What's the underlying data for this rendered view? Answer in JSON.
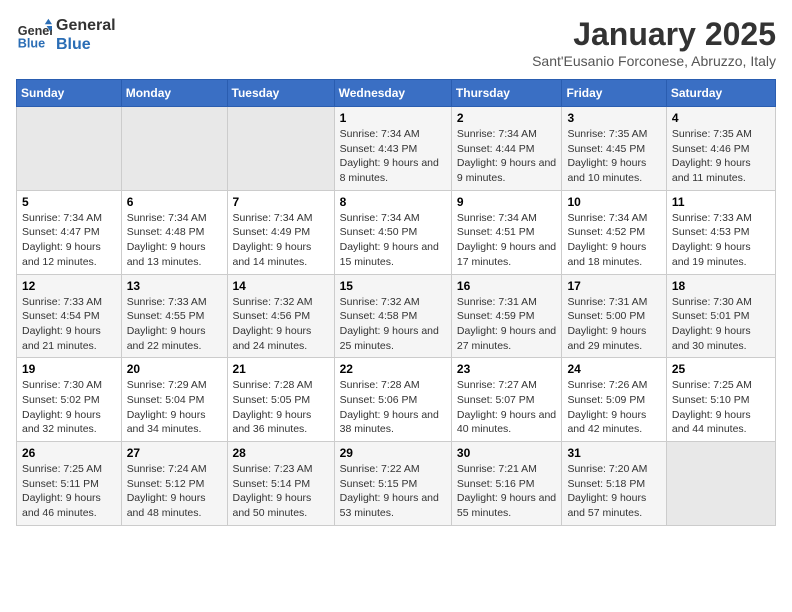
{
  "logo": {
    "text_general": "General",
    "text_blue": "Blue"
  },
  "header": {
    "title": "January 2025",
    "subtitle": "Sant'Eusanio Forconese, Abruzzo, Italy"
  },
  "days_of_week": [
    "Sunday",
    "Monday",
    "Tuesday",
    "Wednesday",
    "Thursday",
    "Friday",
    "Saturday"
  ],
  "weeks": [
    [
      {
        "day": "",
        "info": ""
      },
      {
        "day": "",
        "info": ""
      },
      {
        "day": "",
        "info": ""
      },
      {
        "day": "1",
        "info": "Sunrise: 7:34 AM\nSunset: 4:43 PM\nDaylight: 9 hours and 8 minutes."
      },
      {
        "day": "2",
        "info": "Sunrise: 7:34 AM\nSunset: 4:44 PM\nDaylight: 9 hours and 9 minutes."
      },
      {
        "day": "3",
        "info": "Sunrise: 7:35 AM\nSunset: 4:45 PM\nDaylight: 9 hours and 10 minutes."
      },
      {
        "day": "4",
        "info": "Sunrise: 7:35 AM\nSunset: 4:46 PM\nDaylight: 9 hours and 11 minutes."
      }
    ],
    [
      {
        "day": "5",
        "info": "Sunrise: 7:34 AM\nSunset: 4:47 PM\nDaylight: 9 hours and 12 minutes."
      },
      {
        "day": "6",
        "info": "Sunrise: 7:34 AM\nSunset: 4:48 PM\nDaylight: 9 hours and 13 minutes."
      },
      {
        "day": "7",
        "info": "Sunrise: 7:34 AM\nSunset: 4:49 PM\nDaylight: 9 hours and 14 minutes."
      },
      {
        "day": "8",
        "info": "Sunrise: 7:34 AM\nSunset: 4:50 PM\nDaylight: 9 hours and 15 minutes."
      },
      {
        "day": "9",
        "info": "Sunrise: 7:34 AM\nSunset: 4:51 PM\nDaylight: 9 hours and 17 minutes."
      },
      {
        "day": "10",
        "info": "Sunrise: 7:34 AM\nSunset: 4:52 PM\nDaylight: 9 hours and 18 minutes."
      },
      {
        "day": "11",
        "info": "Sunrise: 7:33 AM\nSunset: 4:53 PM\nDaylight: 9 hours and 19 minutes."
      }
    ],
    [
      {
        "day": "12",
        "info": "Sunrise: 7:33 AM\nSunset: 4:54 PM\nDaylight: 9 hours and 21 minutes."
      },
      {
        "day": "13",
        "info": "Sunrise: 7:33 AM\nSunset: 4:55 PM\nDaylight: 9 hours and 22 minutes."
      },
      {
        "day": "14",
        "info": "Sunrise: 7:32 AM\nSunset: 4:56 PM\nDaylight: 9 hours and 24 minutes."
      },
      {
        "day": "15",
        "info": "Sunrise: 7:32 AM\nSunset: 4:58 PM\nDaylight: 9 hours and 25 minutes."
      },
      {
        "day": "16",
        "info": "Sunrise: 7:31 AM\nSunset: 4:59 PM\nDaylight: 9 hours and 27 minutes."
      },
      {
        "day": "17",
        "info": "Sunrise: 7:31 AM\nSunset: 5:00 PM\nDaylight: 9 hours and 29 minutes."
      },
      {
        "day": "18",
        "info": "Sunrise: 7:30 AM\nSunset: 5:01 PM\nDaylight: 9 hours and 30 minutes."
      }
    ],
    [
      {
        "day": "19",
        "info": "Sunrise: 7:30 AM\nSunset: 5:02 PM\nDaylight: 9 hours and 32 minutes."
      },
      {
        "day": "20",
        "info": "Sunrise: 7:29 AM\nSunset: 5:04 PM\nDaylight: 9 hours and 34 minutes."
      },
      {
        "day": "21",
        "info": "Sunrise: 7:28 AM\nSunset: 5:05 PM\nDaylight: 9 hours and 36 minutes."
      },
      {
        "day": "22",
        "info": "Sunrise: 7:28 AM\nSunset: 5:06 PM\nDaylight: 9 hours and 38 minutes."
      },
      {
        "day": "23",
        "info": "Sunrise: 7:27 AM\nSunset: 5:07 PM\nDaylight: 9 hours and 40 minutes."
      },
      {
        "day": "24",
        "info": "Sunrise: 7:26 AM\nSunset: 5:09 PM\nDaylight: 9 hours and 42 minutes."
      },
      {
        "day": "25",
        "info": "Sunrise: 7:25 AM\nSunset: 5:10 PM\nDaylight: 9 hours and 44 minutes."
      }
    ],
    [
      {
        "day": "26",
        "info": "Sunrise: 7:25 AM\nSunset: 5:11 PM\nDaylight: 9 hours and 46 minutes."
      },
      {
        "day": "27",
        "info": "Sunrise: 7:24 AM\nSunset: 5:12 PM\nDaylight: 9 hours and 48 minutes."
      },
      {
        "day": "28",
        "info": "Sunrise: 7:23 AM\nSunset: 5:14 PM\nDaylight: 9 hours and 50 minutes."
      },
      {
        "day": "29",
        "info": "Sunrise: 7:22 AM\nSunset: 5:15 PM\nDaylight: 9 hours and 53 minutes."
      },
      {
        "day": "30",
        "info": "Sunrise: 7:21 AM\nSunset: 5:16 PM\nDaylight: 9 hours and 55 minutes."
      },
      {
        "day": "31",
        "info": "Sunrise: 7:20 AM\nSunset: 5:18 PM\nDaylight: 9 hours and 57 minutes."
      },
      {
        "day": "",
        "info": ""
      }
    ]
  ]
}
